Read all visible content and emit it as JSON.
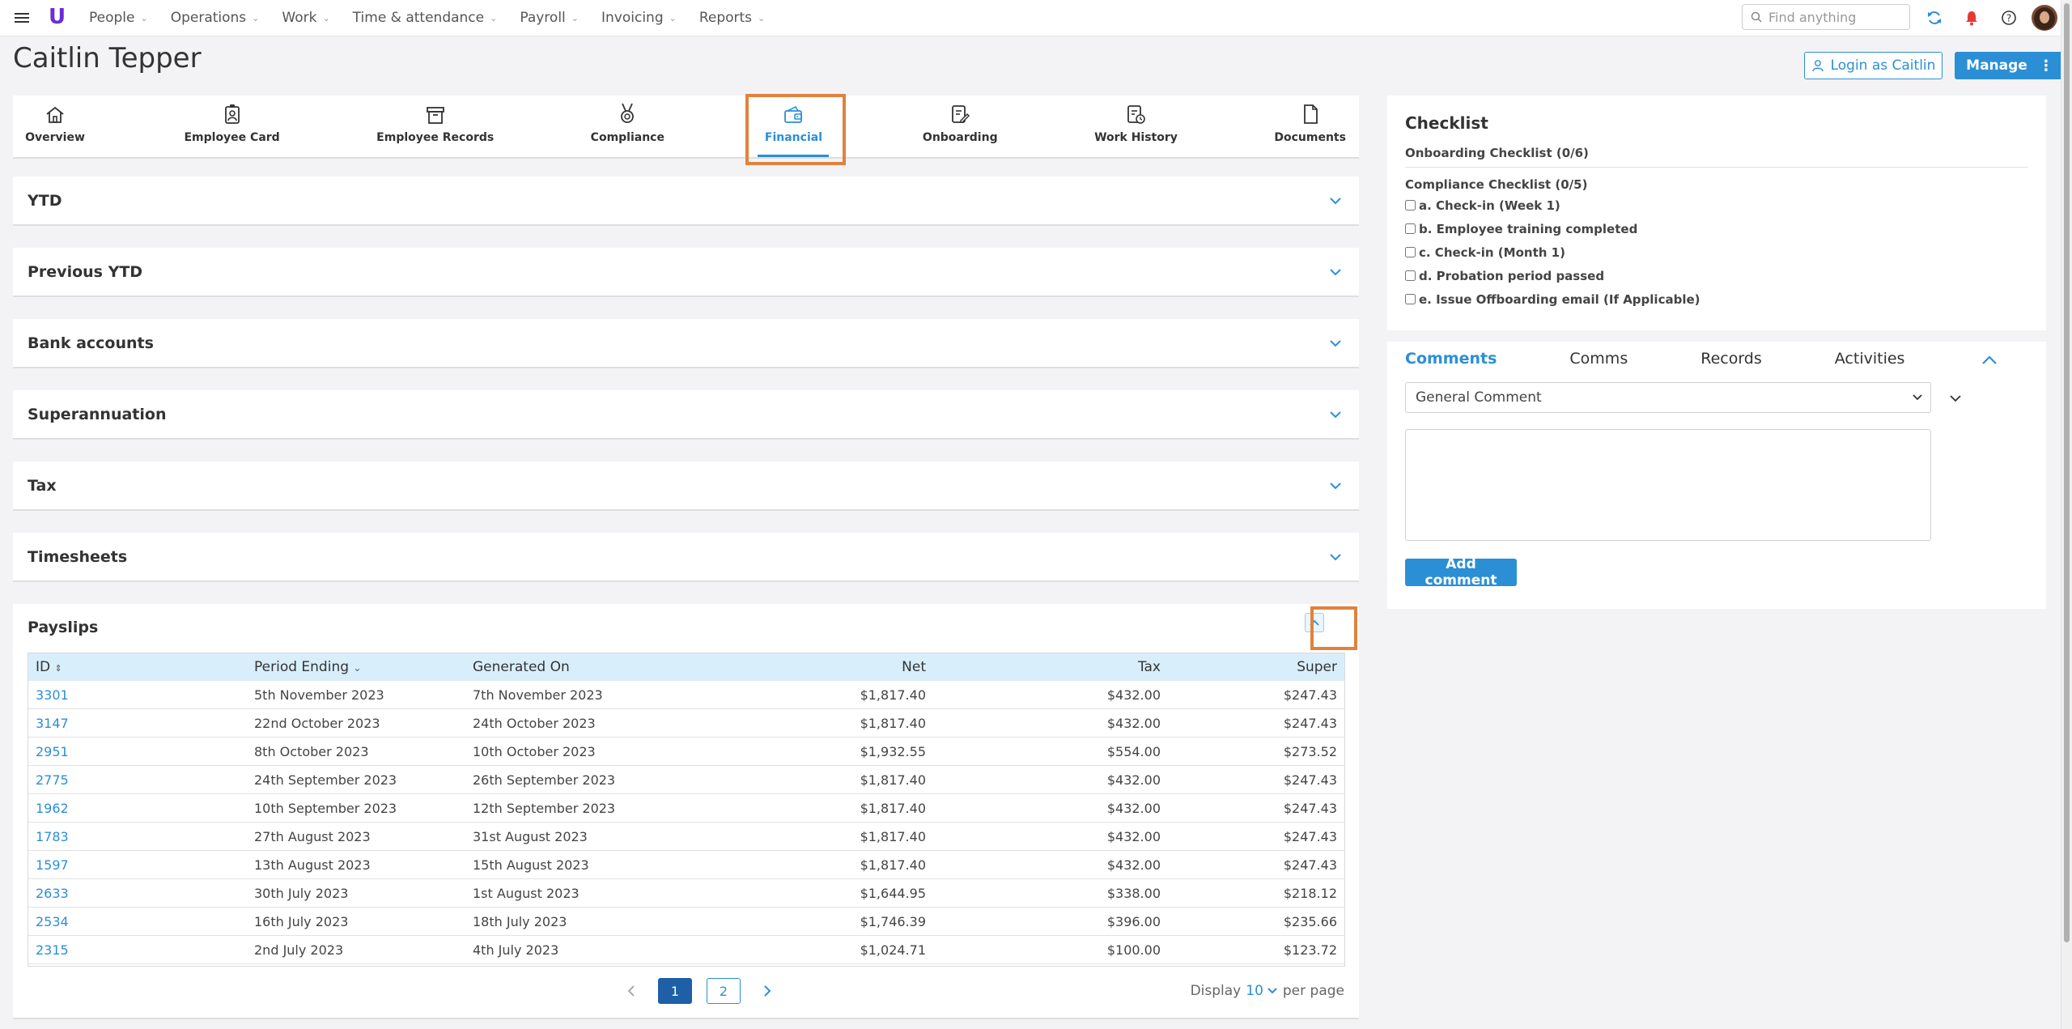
{
  "app": {
    "logo": "U",
    "nav": [
      "People",
      "Operations",
      "Work",
      "Time & attendance",
      "Payroll",
      "Invoicing",
      "Reports"
    ],
    "search_placeholder": "Find anything"
  },
  "page": {
    "title": "Caitlin Tepper",
    "login_button": "Login as Caitlin",
    "manage_button": "Manage"
  },
  "tabs": [
    {
      "label": "Overview",
      "icon": "home-icon"
    },
    {
      "label": "Employee Card",
      "icon": "id-badge-icon"
    },
    {
      "label": "Employee Records",
      "icon": "archive-icon"
    },
    {
      "label": "Compliance",
      "icon": "medal-icon"
    },
    {
      "label": "Financial",
      "icon": "wallet-icon",
      "active": true
    },
    {
      "label": "Onboarding",
      "icon": "clipboard-edit-icon"
    },
    {
      "label": "Work History",
      "icon": "document-clock-icon"
    },
    {
      "label": "Documents",
      "icon": "document-icon"
    }
  ],
  "sections": [
    "YTD",
    "Previous YTD",
    "Bank accounts",
    "Superannuation",
    "Tax",
    "Timesheets"
  ],
  "payslips": {
    "title": "Payslips",
    "columns": [
      "ID",
      "Period Ending",
      "Generated On",
      "Net",
      "Tax",
      "Super"
    ],
    "rows": [
      [
        "3301",
        "5th November 2023",
        "7th November 2023",
        "$1,817.40",
        "$432.00",
        "$247.43"
      ],
      [
        "3147",
        "22nd October 2023",
        "24th October 2023",
        "$1,817.40",
        "$432.00",
        "$247.43"
      ],
      [
        "2951",
        "8th October 2023",
        "10th October 2023",
        "$1,932.55",
        "$554.00",
        "$273.52"
      ],
      [
        "2775",
        "24th September 2023",
        "26th September 2023",
        "$1,817.40",
        "$432.00",
        "$247.43"
      ],
      [
        "1962",
        "10th September 2023",
        "12th September 2023",
        "$1,817.40",
        "$432.00",
        "$247.43"
      ],
      [
        "1783",
        "27th August 2023",
        "31st August 2023",
        "$1,817.40",
        "$432.00",
        "$247.43"
      ],
      [
        "1597",
        "13th August 2023",
        "15th August 2023",
        "$1,817.40",
        "$432.00",
        "$247.43"
      ],
      [
        "2633",
        "30th July 2023",
        "1st August 2023",
        "$1,644.95",
        "$338.00",
        "$218.12"
      ],
      [
        "2534",
        "16th July 2023",
        "18th July 2023",
        "$1,746.39",
        "$396.00",
        "$235.66"
      ],
      [
        "2315",
        "2nd July 2023",
        "4th July 2023",
        "$1,024.71",
        "$100.00",
        "$123.72"
      ]
    ],
    "pages": [
      "1",
      "2"
    ],
    "current_page": "1",
    "display_label": "Display",
    "per_page_value": "10",
    "per_page_label": "per page"
  },
  "checklist": {
    "title": "Checklist",
    "onboarding": "Onboarding Checklist (0/6)",
    "compliance": "Compliance Checklist (0/5)",
    "items": [
      "a. Check-in (Week 1)",
      "b. Employee training completed",
      "c. Check-in (Month 1)",
      "d. Probation period passed",
      "e. Issue Offboarding email (If Applicable)"
    ]
  },
  "comments": {
    "tabs": [
      "Comments",
      "Comms",
      "Records",
      "Activities"
    ],
    "active_tab": "Comments",
    "select_value": "General Comment",
    "add_button": "Add comment"
  },
  "colors": {
    "accent": "#2b8fd6",
    "highlight": "#e0823d",
    "table_header": "#d9eefb",
    "logo": "#6a2bd9"
  }
}
